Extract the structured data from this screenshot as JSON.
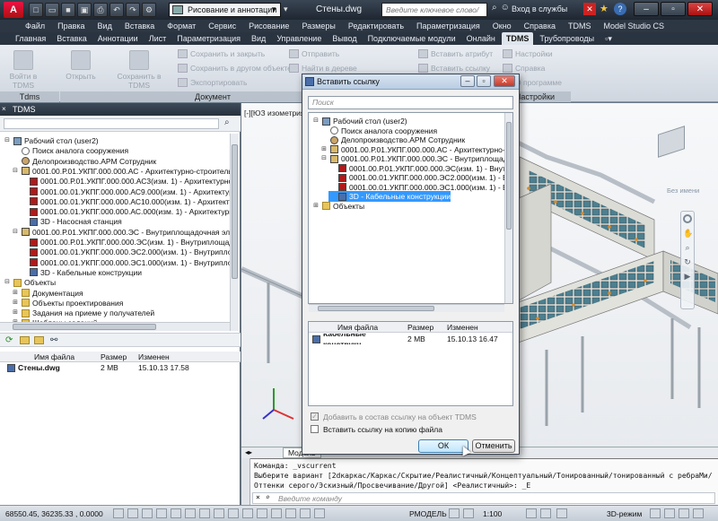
{
  "app": {
    "doc_title": "Стены.dwg",
    "workspace": "Рисование и аннотации",
    "search_placeholder": "Введите ключевое слово/фразу",
    "login": "Вход в службы"
  },
  "menu": [
    "Файл",
    "Правка",
    "Вид",
    "Вставка",
    "Формат",
    "Сервис",
    "Рисование",
    "Размеры",
    "Редактировать",
    "Параметризация",
    "Окно",
    "Справка",
    "TDMS",
    "Model Studio CS"
  ],
  "ribbon_tabs": [
    "Главная",
    "Вставка",
    "Аннотации",
    "Лист",
    "Параметризация",
    "Вид",
    "Управление",
    "Вывод",
    "Подключаемые модули",
    "Онлайн",
    "TDMS",
    "Трубопроводы"
  ],
  "ribbon_active_tab": "TDMS",
  "ribbon": {
    "login_btn": "Войти в TDMS",
    "open_btn": "Открыть",
    "save_btn": "Сохранить в TDMS",
    "save_close": "Сохранить и закрыть",
    "save_other": "Сохранить в другом объекте",
    "export": "Экспортировать",
    "send": "Отправить",
    "find_tree": "Найти в дереве",
    "insert_attr": "Вставить атрибут",
    "insert_link": "Вставить ссылку",
    "settings": "Настройки",
    "help": "Справка",
    "about": "О программе",
    "group_tdms": "Tdms",
    "group_doc": "Документ",
    "group_settings": "Настройки"
  },
  "left_panel": {
    "title": "TDMS",
    "tree": [
      {
        "label": "Рабочий стол (user2)",
        "icon": "desk",
        "level": 0,
        "toggle": "-"
      },
      {
        "label": "Поиск аналога сооружения",
        "icon": "search",
        "level": 1,
        "toggle": ""
      },
      {
        "label": "Делопроизводство.АРМ Сотрудник",
        "icon": "user",
        "level": 1,
        "toggle": ""
      },
      {
        "label": "0001.00.Р.01.УКПГ.000.000.АС - Архитектурно-строительн",
        "icon": "obj",
        "level": 1,
        "toggle": "-"
      },
      {
        "label": "0001.00.Р.01.УКПГ.000.000.АС3(изм. 1) - Архитектурно",
        "icon": "doc",
        "level": 2,
        "toggle": ""
      },
      {
        "label": "0001.00.01.УКПГ.000.000.АС9.000(изм. 1) - Архитектур",
        "icon": "doc",
        "level": 2,
        "toggle": ""
      },
      {
        "label": "0001.00.01.УКПГ.000.000.АС10.000(изм. 1) - Архитекту",
        "icon": "doc",
        "level": 2,
        "toggle": ""
      },
      {
        "label": "0001.00.01.УКПГ.000.000.АС.000(изм. 1) - Архитектурн",
        "icon": "doc",
        "level": 2,
        "toggle": ""
      },
      {
        "label": "3D - Насосная станция",
        "icon": "model",
        "level": 2,
        "toggle": ""
      },
      {
        "label": "0001.00.Р.01.УКПГ.000.000.ЭС - Внутриплощадочная элек",
        "icon": "obj",
        "level": 1,
        "toggle": "-"
      },
      {
        "label": "0001.00.Р.01.УКПГ.000.000.ЭС(изм. 1) - Внутриплощадо",
        "icon": "doc",
        "level": 2,
        "toggle": ""
      },
      {
        "label": "0001.00.01.УКПГ.000.000.ЭС2.000(изм. 1) - Внутриплощ",
        "icon": "doc",
        "level": 2,
        "toggle": ""
      },
      {
        "label": "0001.00.01.УКПГ.000.000.ЭС1.000(изм. 1) - Внутриплощ",
        "icon": "doc",
        "level": 2,
        "toggle": ""
      },
      {
        "label": "3D - Кабельные конструкции",
        "icon": "model",
        "level": 2,
        "toggle": ""
      },
      {
        "label": "Объекты",
        "icon": "fold",
        "level": 0,
        "toggle": "-"
      },
      {
        "label": "Документация",
        "icon": "fold",
        "level": 1,
        "toggle": "+"
      },
      {
        "label": "Объекты проектирования",
        "icon": "fold",
        "level": 1,
        "toggle": "+"
      },
      {
        "label": "Задания на приеме у получателей",
        "icon": "fold",
        "level": 1,
        "toggle": "+"
      },
      {
        "label": "Шаблоны заданий",
        "icon": "fold",
        "level": 1,
        "toggle": "+"
      }
    ],
    "files_header": [
      "Имя файла",
      "Размер",
      "Изменен"
    ],
    "files": [
      {
        "name": "Стены.dwg",
        "size": "2 MB",
        "modified": "15.10.13 17.58"
      }
    ]
  },
  "viewport": {
    "label": "[-][ЮЗ изометрия]",
    "nav_label": "Без имени",
    "model_tab": "Модель"
  },
  "dialog": {
    "title": "Вставить ссылку",
    "search_placeholder": "Поиск",
    "tree": [
      {
        "label": "Рабочий стол (user2)",
        "icon": "desk",
        "level": 0,
        "toggle": "-",
        "selected": false
      },
      {
        "label": "Поиск аналога сооружения",
        "icon": "search",
        "level": 1,
        "toggle": "",
        "selected": false
      },
      {
        "label": "Делопроизводство.АРМ Сотрудник",
        "icon": "user",
        "level": 1,
        "toggle": "",
        "selected": false
      },
      {
        "label": "0001.00.Р.01.УКПГ.000.000.АС - Архитектурно-строи",
        "icon": "obj",
        "level": 1,
        "toggle": "+",
        "selected": false
      },
      {
        "label": "0001.00.Р.01.УКПГ.000.000.ЭС - Внутриплощадочна",
        "icon": "obj",
        "level": 1,
        "toggle": "-",
        "selected": false
      },
      {
        "label": "0001.00.Р.01.УКПГ.000.000.ЭС(изм. 1) - Внутрипл",
        "icon": "doc",
        "level": 2,
        "toggle": "",
        "selected": false
      },
      {
        "label": "0001.00.01.УКПГ.000.000.ЭС2.000(изм. 1) - Внутри",
        "icon": "doc",
        "level": 2,
        "toggle": "",
        "selected": false
      },
      {
        "label": "0001.00.01.УКПГ.000.000.ЭС1.000(изм. 1) - Внутри",
        "icon": "doc",
        "level": 2,
        "toggle": "",
        "selected": false
      },
      {
        "label": "3D - Кабельные конструкции",
        "icon": "model",
        "level": 2,
        "toggle": "",
        "selected": true
      },
      {
        "label": "Объекты",
        "icon": "fold",
        "level": 0,
        "toggle": "+",
        "selected": false
      }
    ],
    "files_header": [
      "Имя файла",
      "Размер",
      "Изменен"
    ],
    "files": [
      {
        "name": "Кабельные конструкц",
        "size": "2 MB",
        "modified": "15.10.13 16.47"
      }
    ],
    "check_add": "Добавить в состав ссылку на объект TDMS",
    "check_copy": "Вставить ссылку на копию файла",
    "ok": "ОК",
    "cancel": "Отменить"
  },
  "command": {
    "line1": "Команда:  _vscurrent",
    "line2": "Выберите вариант [2dкаркас/Каркас/Скрытие/Реалистичный/Концептуальный/Тонированный/тонированный с ребраМи/",
    "line3": "Оттенки серого/Эскизный/Просвечивание/Другой] <Реалистичный>: _E",
    "prompt": "Введите команду"
  },
  "status": {
    "coords": "68550.45, 36235.33 , 0.0000",
    "model": "РМОДЕЛЬ",
    "scale": "1:100",
    "mode3d": "3D-режим"
  }
}
